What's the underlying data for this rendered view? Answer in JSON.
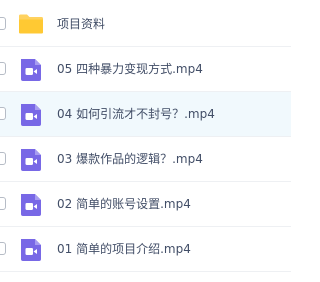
{
  "colors": {
    "folder": "#ffd25f",
    "video_icon": "#7868e6",
    "text": "#424e67",
    "hover_row": "#f1f9fd"
  },
  "files": [
    {
      "type": "folder",
      "icon": "folder-icon",
      "name": "项目资料"
    },
    {
      "type": "video",
      "icon": "video-file-icon",
      "name": "05 四种暴力变现方式.mp4"
    },
    {
      "type": "video",
      "icon": "video-file-icon",
      "name": "04 如何引流才不封号？.mp4"
    },
    {
      "type": "video",
      "icon": "video-file-icon",
      "name": "03 爆款作品的逻辑？.mp4"
    },
    {
      "type": "video",
      "icon": "video-file-icon",
      "name": "02 简单的账号设置.mp4"
    },
    {
      "type": "video",
      "icon": "video-file-icon",
      "name": "01 简单的项目介绍.mp4"
    }
  ]
}
